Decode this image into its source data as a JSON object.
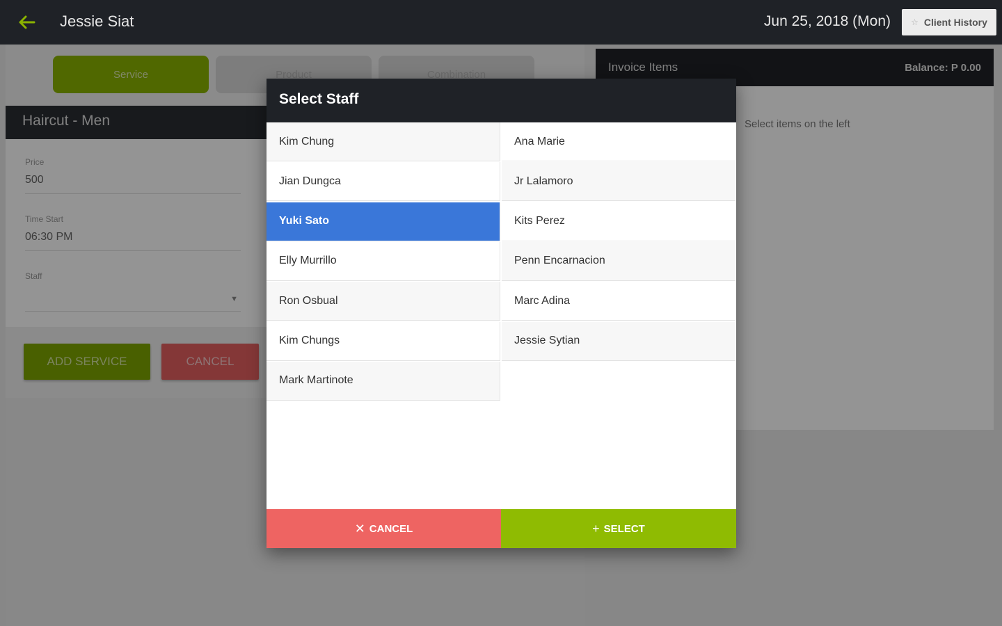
{
  "topbar": {
    "client_name": "Jessie Siat",
    "date": "Jun 25, 2018 (Mon)",
    "client_history_label": "Client History",
    "accent_color": "#8bb300"
  },
  "tabs": [
    {
      "label": "Service",
      "active": true
    },
    {
      "label": "Product",
      "active": false
    },
    {
      "label": "Combination",
      "active": false
    }
  ],
  "service": {
    "title": "Haircut - Men",
    "price_label": "Price",
    "price_value": "500",
    "time_label": "Time Start",
    "time_value": "06:30 PM",
    "staff_label": "Staff",
    "add_label": "ADD SERVICE",
    "cancel_label": "CANCEL"
  },
  "invoice": {
    "title": "Invoice Items",
    "balance": "Balance: P 0.00",
    "hint": "Select items on the left"
  },
  "dialog": {
    "title": "Select Staff",
    "staff": [
      {
        "name": "Kim Chung"
      },
      {
        "name": "Ana Marie"
      },
      {
        "name": "Jian Dungca"
      },
      {
        "name": "Jr Lalamoro"
      },
      {
        "name": "Yuki Sato",
        "selected": true
      },
      {
        "name": "Kits Perez"
      },
      {
        "name": "Elly Murrillo"
      },
      {
        "name": "Penn Encarnacion"
      },
      {
        "name": "Ron Osbual"
      },
      {
        "name": "Marc Adina"
      },
      {
        "name": "Kim Chungs"
      },
      {
        "name": "Jessie Sytian"
      },
      {
        "name": "Mark Martinote"
      }
    ],
    "cancel_label": "CANCEL",
    "select_label": "SELECT",
    "cancel_color": "#ee6462",
    "select_color": "#8fbb02",
    "selected_color": "#3a77d9"
  }
}
